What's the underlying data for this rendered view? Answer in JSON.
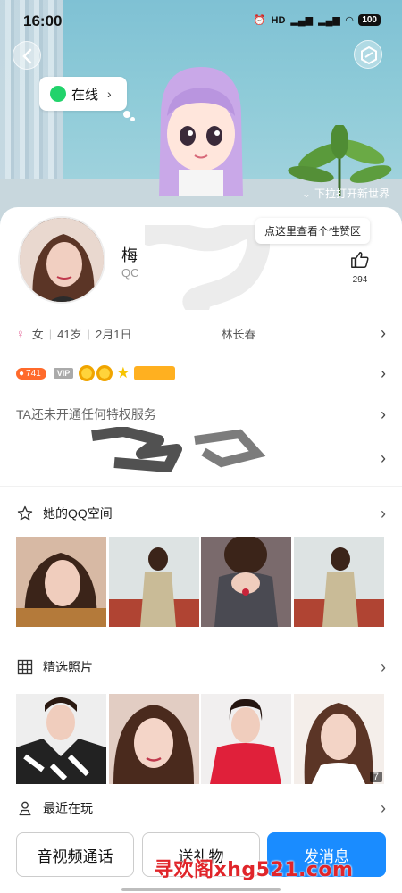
{
  "status_bar": {
    "time": "16:00",
    "battery": "100"
  },
  "hero": {
    "online_label": "在线",
    "pull_hint": "下拉打开新世界"
  },
  "profile": {
    "name": "梅",
    "qq_prefix": "QC",
    "tip": "点这里查看个性赞区",
    "like_count": "294",
    "gender": "女",
    "age": "41岁",
    "birthday": "2月1日",
    "location": "林长春",
    "level": "741",
    "vip": "VIP",
    "privilege_text": "TA还未开通任何特权服务"
  },
  "sections": {
    "qzone": "她的QQ空间",
    "photos": "精选照片",
    "recent": "最近在玩",
    "photo_count": "7"
  },
  "buttons": {
    "call": "音视频通话",
    "gift": "送礼物",
    "message": "发消息"
  },
  "watermark": "寻欢阁xhg521.com",
  "colors": {
    "accent": "#1a8cff",
    "online": "#22d36b",
    "level": "#ff6a2b",
    "watermark": "#e0252a"
  }
}
